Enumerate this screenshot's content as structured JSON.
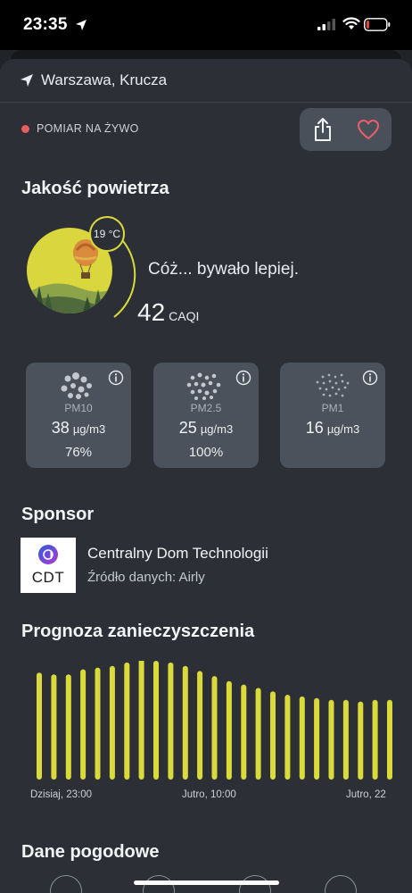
{
  "status_bar": {
    "time": "23:35"
  },
  "location": {
    "name": "Warszawa, Krucza"
  },
  "live": {
    "label": "POMIAR NA ŻYWO",
    "dot_color": "#e55d5d"
  },
  "actions": {
    "share_icon": "share-icon",
    "favorite_icon": "heart-icon"
  },
  "air_quality": {
    "title": "Jakość powietrza",
    "temperature": "19 °C",
    "verdict": "Cóż... bywało lepiej.",
    "caqi_value": "42",
    "caqi_unit": "CAQI",
    "accent_color": "#dada3a"
  },
  "pm": [
    {
      "name": "PM10",
      "value": "38",
      "unit": "µg/m3",
      "percent": "76%"
    },
    {
      "name": "PM2.5",
      "value": "25",
      "unit": "µg/m3",
      "percent": "100%"
    },
    {
      "name": "PM1",
      "value": "16",
      "unit": "µg/m3",
      "percent": ""
    }
  ],
  "sponsor": {
    "title": "Sponsor",
    "logo_text": "CDT",
    "name": "Centralny Dom Technologii",
    "source": "Źródło danych: Airly"
  },
  "forecast": {
    "title": "Prognoza zanieczyszczenia",
    "start_label": "Dzisiaj, 23:00",
    "mid_label": "Jutro, 10:00",
    "end_label": "Jutro, 22",
    "bar_color": "#dada3a"
  },
  "chart_data": {
    "type": "bar",
    "values": [
      0.63,
      0.62,
      0.62,
      0.65,
      0.66,
      0.67,
      0.69,
      0.71,
      0.7,
      0.69,
      0.67,
      0.64,
      0.61,
      0.58,
      0.56,
      0.54,
      0.52,
      0.5,
      0.49,
      0.48,
      0.47,
      0.47,
      0.46,
      0.47,
      0.47
    ]
  },
  "weather": {
    "title": "Dane pogodowe"
  }
}
